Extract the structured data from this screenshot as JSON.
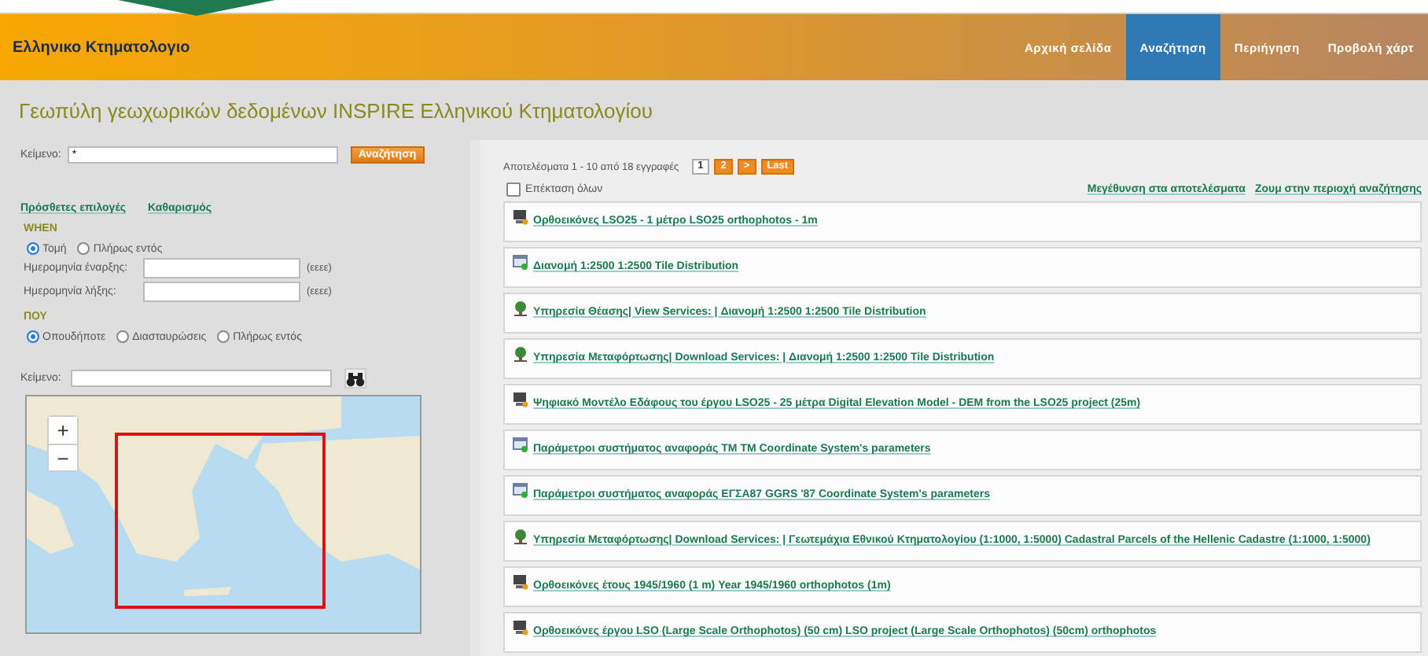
{
  "header": {
    "logo": "Ελληνικο Κτηματολογιο",
    "nav": [
      {
        "label": "Αρχική σελίδα",
        "selected": false
      },
      {
        "label": "Αναζήτηση",
        "selected": true
      },
      {
        "label": "Περιήγηση",
        "selected": false
      },
      {
        "label": "Προβολή χάρτ",
        "selected": false
      }
    ]
  },
  "page_title": "Γεωπύλη γεωχωρικών δεδομένων INSPIRE Ελληνικού Κτηματολογίου",
  "search": {
    "label": "Κείμενο:",
    "value": "*",
    "button": "Αναζήτηση"
  },
  "option_links": [
    "Πρόσθετες επιλογές",
    "Καθαρισμός"
  ],
  "when": {
    "heading": "WHEN",
    "modes": [
      {
        "label": "Τομή",
        "selected": true
      },
      {
        "label": "Πλήρως εντός",
        "selected": false
      }
    ],
    "dates": [
      {
        "label": "Ημερομηνία έναρξης:",
        "hint": "(εεεε)"
      },
      {
        "label": "Ημερομηνία λήξης:",
        "hint": "(εεεε)"
      }
    ]
  },
  "where": {
    "heading": "ΠΟΥ",
    "modes": [
      {
        "label": "Οπουδήποτε",
        "selected": true
      },
      {
        "label": "Διασταυρώσεις",
        "selected": false
      },
      {
        "label": "Πλήρως εντός",
        "selected": false
      }
    ]
  },
  "map_search": {
    "label": "Κείμενο:"
  },
  "map": {
    "zoom_in": "+",
    "zoom_out": "−"
  },
  "results": {
    "summary": "Αποτελέσματα 1 - 10 από 18 εγγραφές",
    "pages": [
      {
        "label": "1",
        "selected": true
      },
      {
        "label": "2",
        "selected": false
      },
      {
        "label": ">",
        "selected": false
      },
      {
        "label": "Last",
        "selected": false
      }
    ],
    "expand_all": {
      "label": "Επέκταση όλων",
      "checked": false
    },
    "links": [
      "Μεγέθυνση στα αποτελέσματα",
      "Ζουμ στην περιοχή αναζήτησης"
    ],
    "items": [
      {
        "kind": "imagery",
        "title": "Ορθοεικόνες LSO25 - 1 μέτρο LSO25 orthophotos - 1m"
      },
      {
        "kind": "dataset",
        "title": "Διανομή 1:2500 1:2500 Tile Distribution"
      },
      {
        "kind": "service",
        "title": "Υπηρεσία Θέασης| View Services: | Διανομή 1:2500 1:2500 Tile Distribution"
      },
      {
        "kind": "service",
        "title": "Υπηρεσία Μεταφόρτωσης| Download Services: | Διανομή 1:2500 1:2500 Tile Distribution"
      },
      {
        "kind": "imagery",
        "title": "Ψηφιακό Μοντέλο Εδάφους του έργου LSO25 - 25 μέτρα Digital Elevation Model - DEM from the LSO25 project (25m)"
      },
      {
        "kind": "dataset",
        "title": "Παράμετροι συστήματος αναφοράς TM TM Coordinate System's parameters"
      },
      {
        "kind": "dataset",
        "title": "Παράμετροι συστήματος αναφοράς ΕΓΣΑ87 GGRS '87 Coordinate System's parameters"
      },
      {
        "kind": "service",
        "title": "Υπηρεσία Μεταφόρτωσης| Download Services: | Γεωτεμάχια Εθνικού Κτηματολογίου (1:1000, 1:5000) Cadastral Parcels of the Hellenic Cadastre (1:1000, 1:5000)"
      },
      {
        "kind": "imagery",
        "title": "Ορθοεικόνες έτους 1945/1960 (1 m) Year 1945/1960 orthophotos (1m)"
      },
      {
        "kind": "imagery",
        "title": "Ορθοεικόνες έργου LSO (Large Scale Orthophotos) (50 cm) LSO project (Large Scale Orthophotos) (50cm) orthophotos"
      }
    ]
  }
}
